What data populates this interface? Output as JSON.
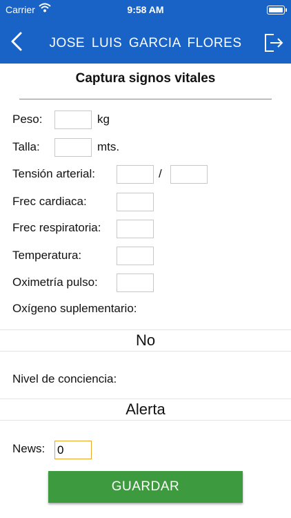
{
  "status_bar": {
    "carrier": "Carrier",
    "time": "9:58 AM"
  },
  "nav": {
    "title": "JOSE LUIS  GARCIA  FLORES"
  },
  "page": {
    "title": "Captura signos vitales"
  },
  "form": {
    "peso": {
      "label": "Peso:",
      "unit": "kg",
      "value": ""
    },
    "talla": {
      "label": "Talla:",
      "unit": "mts.",
      "value": ""
    },
    "tension": {
      "label": "Tensión arterial:",
      "separator": "/",
      "systolic": "",
      "diastolic": ""
    },
    "frec_cardiaca": {
      "label": "Frec cardiaca:",
      "value": ""
    },
    "frec_respiratoria": {
      "label": "Frec respiratoria:",
      "value": ""
    },
    "temperatura": {
      "label": "Temperatura:",
      "value": ""
    },
    "oximetria": {
      "label": "Oximetría pulso:",
      "value": ""
    },
    "oxigeno": {
      "label": "Oxígeno suplementario:",
      "selected": "No"
    },
    "conciencia": {
      "label": "Nivel de conciencia:",
      "selected": "Alerta"
    },
    "news": {
      "label": "News:",
      "value": "0"
    }
  },
  "actions": {
    "save_label": "GUARDAR"
  }
}
